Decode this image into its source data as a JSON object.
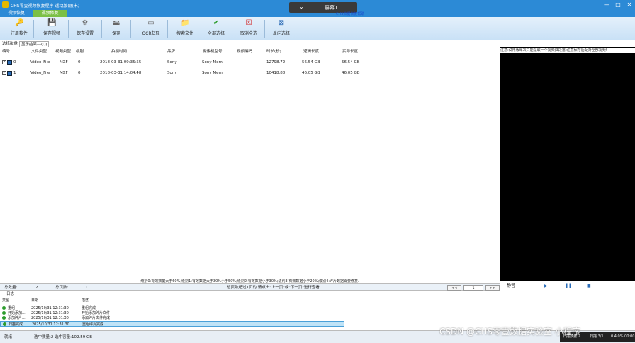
{
  "app": {
    "title": "CHS零壹视频恢复程序 适动版(展末)",
    "window_buttons": [
      "—",
      "□",
      "✕"
    ]
  },
  "top_tabs": [
    "视频恢复",
    "视频修复"
  ],
  "screen_selector": {
    "chevron": "⌄",
    "label": "屏幕1"
  },
  "tip_link": "CHS数据恢复帮助",
  "toolbar": [
    {
      "label": "注册软件",
      "icon": "key-icon",
      "glyph": "🔑"
    },
    {
      "label": "保存视频",
      "icon": "disk-icon",
      "glyph": "💾"
    },
    {
      "label": "保存设置",
      "icon": "settings-icon",
      "glyph": "⚙"
    },
    {
      "label": "保存",
      "icon": "drive-icon",
      "glyph": "🖴"
    },
    {
      "label": "OCR获取",
      "icon": "ocr-icon",
      "glyph": "▭"
    },
    {
      "label": "搜索文件",
      "icon": "folder-icon",
      "glyph": "📁"
    },
    {
      "label": "全部选择",
      "icon": "check-icon",
      "glyph": "✔"
    },
    {
      "label": "取消全选",
      "icon": "cancel-icon",
      "glyph": "☒"
    },
    {
      "label": "反向选择",
      "icon": "invert-icon",
      "glyph": "⊠"
    }
  ],
  "subtabs": [
    "选择磁盘",
    "显示结果---(Q)"
  ],
  "right_tip": "注意:试用版每次只能提取一个视频(3段落)注意保存后配对全部视频!",
  "table": {
    "headers": [
      "编号",
      "文件类型",
      "视频类型",
      "级别",
      "拍摄时间",
      "品牌",
      "摄像机型号",
      "视频编码",
      "时长(秒)",
      "逻辑长度",
      "实际长度"
    ],
    "rows": [
      [
        "0",
        "Video_File",
        "MXF",
        "0",
        "2018-03-31 09:35:55",
        "Sony",
        "Sony Mem",
        "",
        "12798.72",
        "56.54 GB",
        "56.54 GB"
      ],
      [
        "1",
        "Video_File",
        "MXF",
        "0",
        "2018-03-31 14:04:48",
        "Sony",
        "Sony Mem",
        "",
        "10418.88",
        "46.05 GB",
        "46.05 GB"
      ]
    ]
  },
  "legend_text": "级别0:有效数据大于60%;级别1:有效数据大于30%小于50%;级别2:有效数据小于30%;级别3:有效数据小于20%;级别4:碎片数据需要修复.",
  "pager": {
    "total_label": "总数量:",
    "total": "2",
    "pages_label": "总页数:",
    "pages": "1",
    "hint": "总页数超过1页的,请点击\"上一页\"或\"下一页\"进行查看",
    "prev": "<<",
    "current": "1",
    "next": ">>"
  },
  "player": {
    "mute": "静音",
    "play": "▶",
    "pause": "❚❚",
    "stop": "■"
  },
  "log": {
    "caption": "日志",
    "headers": [
      "类型",
      "日期",
      "描述"
    ],
    "rows": [
      [
        "重组",
        "2025/10/31 12:31:30",
        "重组完成"
      ],
      [
        "开始添加...",
        "2025/10/31 12:31:30",
        "开始添加碎片文件"
      ],
      [
        "添加碎片...",
        "2025/10/31 12:31:30",
        "添加碎片文件完成"
      ],
      [
        "扫描完成",
        "2025/10/31 12:31:30",
        "重组碎片完成"
      ]
    ]
  },
  "status": {
    "left": "就绪",
    "selection": "选中数量:2 选中容量:102.59 GB"
  },
  "watermark": "CSDN @CHS零壹数据实验室 小程序",
  "taskbar": {
    "a": "扫描数量 2",
    "b": "扫描 3/1 ",
    "c": "0.4 0% 00:00"
  }
}
